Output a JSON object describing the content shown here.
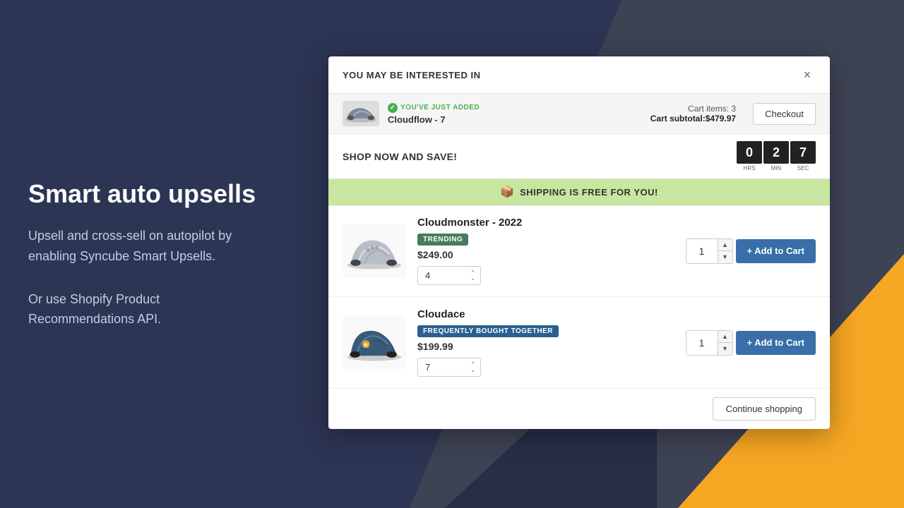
{
  "background": {
    "primary_color": "#2d3554",
    "accent_color": "#f5a623"
  },
  "left_panel": {
    "heading": "Smart auto upsells",
    "paragraph1": "Upsell and cross-sell on autopilot by enabling Syncube Smart Upsells.",
    "paragraph2": "Or use Shopify Product Recommendations API."
  },
  "modal": {
    "title": "YOU MAY BE INTERESTED IN",
    "close_label": "×",
    "cart_bar": {
      "added_label": "YOU'VE JUST ADDED",
      "product_name": "Cloudflow - 7",
      "cart_items_label": "Cart items: 3",
      "cart_subtotal_label": "Cart subtotal:",
      "cart_subtotal_value": "$479.97",
      "checkout_label": "Checkout"
    },
    "shop_bar": {
      "text": "SHOP NOW AND SAVE!",
      "countdown": {
        "hrs": "0",
        "hrs_label": "HRS",
        "min": "2",
        "min_label": "MIN",
        "sec": "7",
        "sec_label": "SEC"
      }
    },
    "shipping_banner": {
      "text": "SHIPPING IS FREE FOR YOU!"
    },
    "products": [
      {
        "name": "Cloudmonster - 2022",
        "badge": "TRENDING",
        "badge_type": "trending",
        "price": "$249.00",
        "size_value": "4",
        "qty": "1",
        "add_to_cart_label": "+ Add to Cart"
      },
      {
        "name": "Cloudace",
        "badge": "FREQUENTLY BOUGHT TOGETHER",
        "badge_type": "fbt",
        "price": "$199.99",
        "size_value": "7",
        "qty": "1",
        "add_to_cart_label": "+ Add to Cart"
      }
    ],
    "footer": {
      "continue_label": "Continue shopping"
    }
  }
}
